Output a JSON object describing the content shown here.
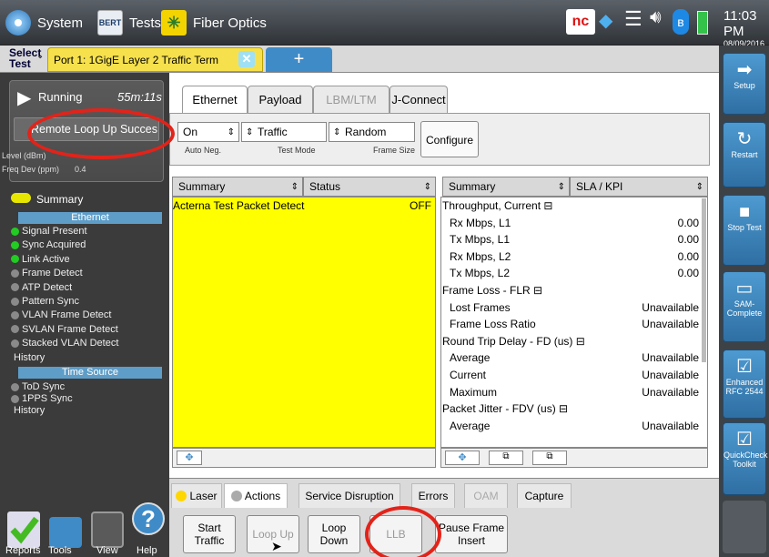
{
  "topbar": {
    "system_label": "System",
    "tests_label": "Tests",
    "tests_icon_text": "BERT",
    "fiber_label": "Fiber Optics",
    "nc_text": "nc",
    "time": "11:03 PM",
    "date": "08/09/2016"
  },
  "tabrow": {
    "select_test": "Select Test",
    "test_name": "Port 1: 1GigE Layer 2 Traffic Term",
    "add_tab": "+"
  },
  "status": {
    "state": "Running",
    "elapsed": "55m:11s",
    "message": "Remote Loop Up Succes",
    "level_label": "Level (dBm)",
    "freq_label": "Freq Dev (ppm)",
    "freq_value": "0.4"
  },
  "tree": {
    "summary": "Summary",
    "ethernet": "Ethernet",
    "items": [
      {
        "label": "Signal Present",
        "state": "green"
      },
      {
        "label": "Sync Acquired",
        "state": "green"
      },
      {
        "label": "Link Active",
        "state": "green"
      },
      {
        "label": "Frame Detect",
        "state": "gray"
      },
      {
        "label": "ATP Detect",
        "state": "gray"
      },
      {
        "label": "Pattern Sync",
        "state": "gray"
      },
      {
        "label": "VLAN Frame Detect",
        "state": "gray"
      },
      {
        "label": "SVLAN Frame Detect",
        "state": "gray"
      },
      {
        "label": "Stacked VLAN Detect",
        "state": "gray"
      },
      {
        "label": "History",
        "state": "none"
      }
    ],
    "time_source": "Time Source",
    "time_items": [
      {
        "label": "ToD Sync",
        "state": "gray"
      },
      {
        "label": "1PPS Sync",
        "state": "gray"
      },
      {
        "label": "History",
        "state": "none"
      }
    ]
  },
  "bottom_left": {
    "reports": "Reports",
    "tools": "Tools",
    "view": "View",
    "help": "Help"
  },
  "config_tabs": [
    "Ethernet",
    "Payload",
    "LBM/LTM",
    "J-Connect"
  ],
  "selectors": [
    {
      "value": "On",
      "sub": "Auto Neg."
    },
    {
      "value": "Traffic",
      "sub": "Test Mode"
    },
    {
      "value": "Random",
      "sub": "Frame Size"
    }
  ],
  "configure_label": "Configure",
  "left_table": {
    "col1": "Summary",
    "col2": "Status",
    "row_label": "Acterna Test Packet Detect",
    "row_value": "OFF"
  },
  "right_table": {
    "col1": "Summary",
    "col2": "SLA / KPI",
    "rows": [
      {
        "label": "Throughput, Current ⊟",
        "value": "",
        "group": true
      },
      {
        "label": "Rx Mbps, L1",
        "value": "0.00",
        "group": false
      },
      {
        "label": "Tx Mbps, L1",
        "value": "0.00",
        "group": false
      },
      {
        "label": "Rx Mbps, L2",
        "value": "0.00",
        "group": false
      },
      {
        "label": "Tx Mbps, L2",
        "value": "0.00",
        "group": false
      },
      {
        "label": "Frame Loss - FLR ⊟",
        "value": "",
        "group": true
      },
      {
        "label": "Lost Frames",
        "value": "Unavailable",
        "group": false
      },
      {
        "label": "Frame Loss Ratio",
        "value": "Unavailable",
        "group": false
      },
      {
        "label": "Round Trip Delay - FD (us) ⊟",
        "value": "",
        "group": true
      },
      {
        "label": "Average",
        "value": "Unavailable",
        "group": false
      },
      {
        "label": "Current",
        "value": "Unavailable",
        "group": false
      },
      {
        "label": "Maximum",
        "value": "Unavailable",
        "group": false
      },
      {
        "label": "Packet Jitter - FDV (us) ⊟",
        "value": "",
        "group": true
      },
      {
        "label": "Average",
        "value": "Unavailable",
        "group": false
      }
    ]
  },
  "bottom_tabs": [
    "Laser",
    "Actions",
    "Service Disruption",
    "Errors",
    "OAM",
    "Capture"
  ],
  "actions": {
    "start": "Start Traffic",
    "loop_up": "Loop Up",
    "loop_down": "Loop Down",
    "llb": "LLB",
    "pause": "Pause Frame Insert"
  },
  "sidebar": {
    "setup": "Setup",
    "restart": "Restart",
    "stop": "Stop Test",
    "sam": "SAM-Complete",
    "enhanced": "Enhanced RFC 2544",
    "quickcheck": "QuickCheck Toolkit"
  },
  "colors": {
    "accent_blue": "#3f8bc7",
    "highlight_yellow": "#ffff00",
    "annotation_red": "#e2231a",
    "status_green": "#22cc22"
  }
}
